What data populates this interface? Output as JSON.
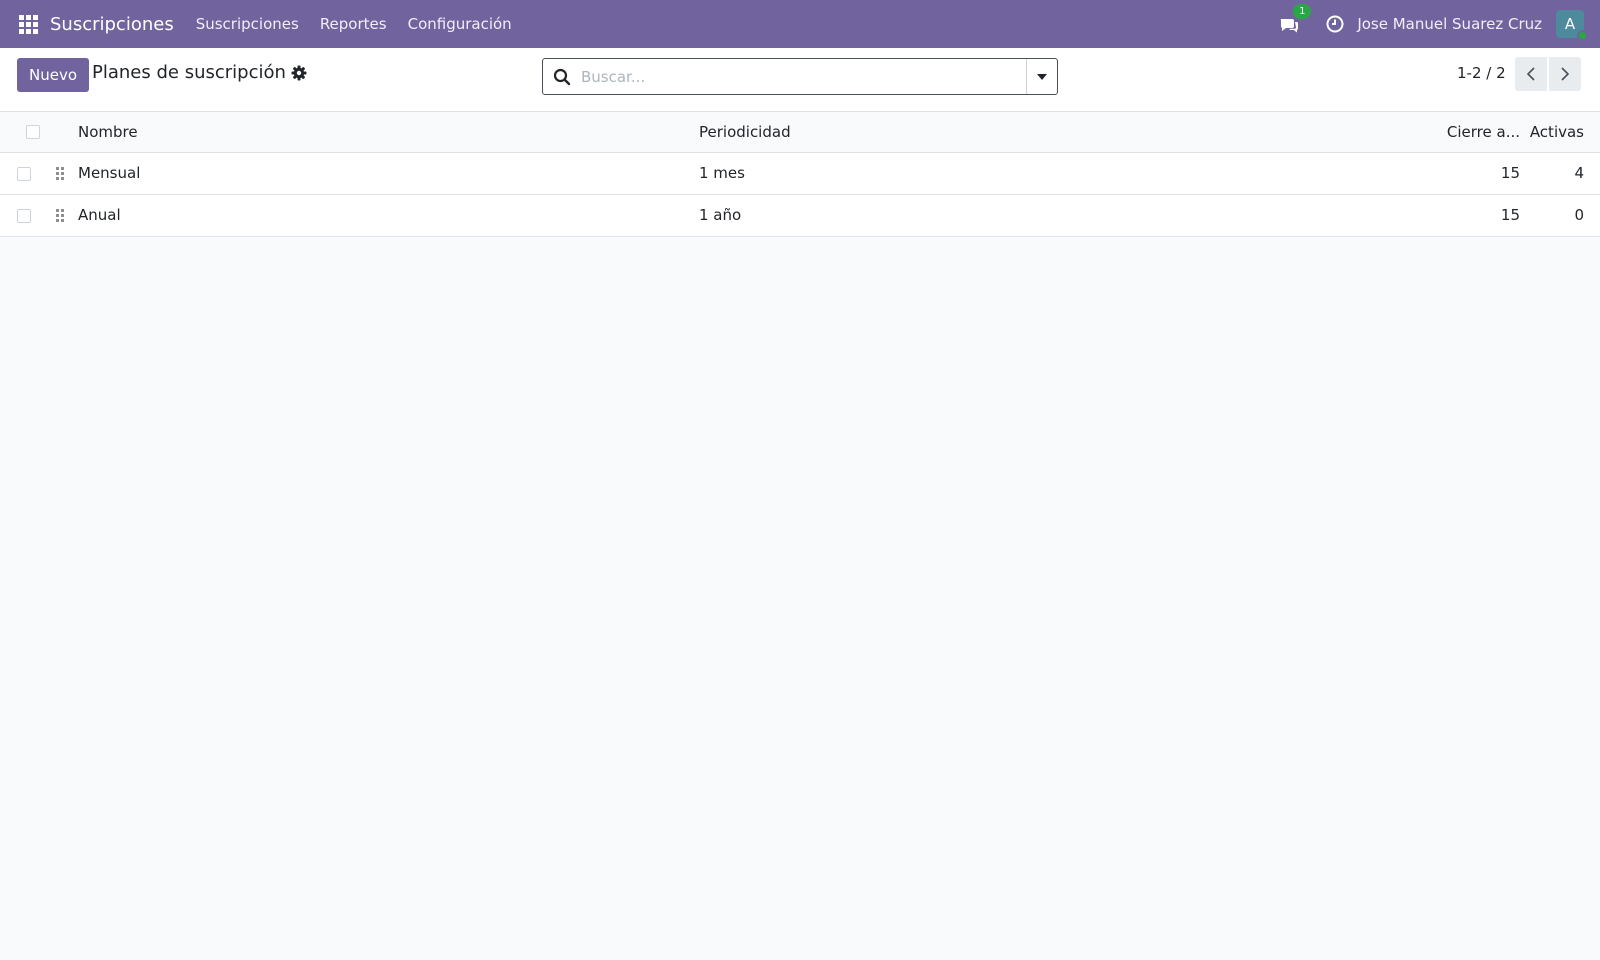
{
  "navbar": {
    "app_title": "Suscripciones",
    "menu": [
      "Suscripciones",
      "Reportes",
      "Configuración"
    ],
    "chat_count": "1",
    "user_name": "Jose Manuel Suarez Cruz",
    "avatar_letter": "A",
    "brand_color": "#71639e"
  },
  "control_panel": {
    "new_label": "Nuevo",
    "title": "Planes de suscripción",
    "search_placeholder": "Buscar...",
    "pager": "1-2 / 2"
  },
  "table": {
    "headers": {
      "name": "Nombre",
      "periodicity": "Periodicidad",
      "closing": "Cierre a...",
      "active": "Activas"
    },
    "rows": [
      {
        "name": "Mensual",
        "periodicity": "1 mes",
        "closing": "15",
        "active": "4"
      },
      {
        "name": "Anual",
        "periodicity": "1 año",
        "closing": "15",
        "active": "0"
      }
    ]
  }
}
